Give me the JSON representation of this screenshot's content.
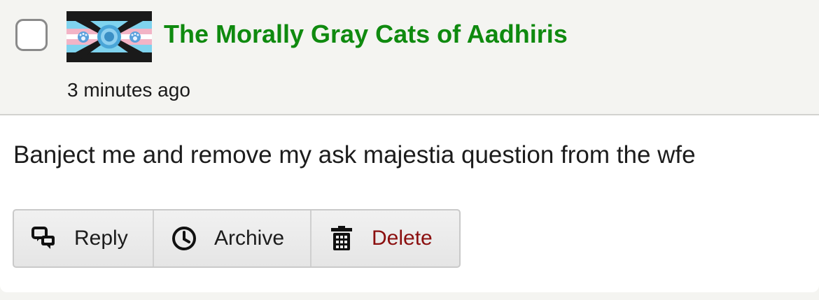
{
  "message": {
    "sender": "The Morally Gray Cats of Aadhiris",
    "timestamp": "3 minutes ago",
    "body": "Banject me and remove my ask majestia question from the wfe"
  },
  "actions": [
    {
      "label": "Reply",
      "icon": "reply-icon"
    },
    {
      "label": "Archive",
      "icon": "clock-icon"
    },
    {
      "label": "Delete",
      "icon": "trash-icon"
    }
  ],
  "colors": {
    "sender": "#0f8a0f",
    "delete": "#8b0f0f",
    "header_bg": "#f4f4f1"
  }
}
